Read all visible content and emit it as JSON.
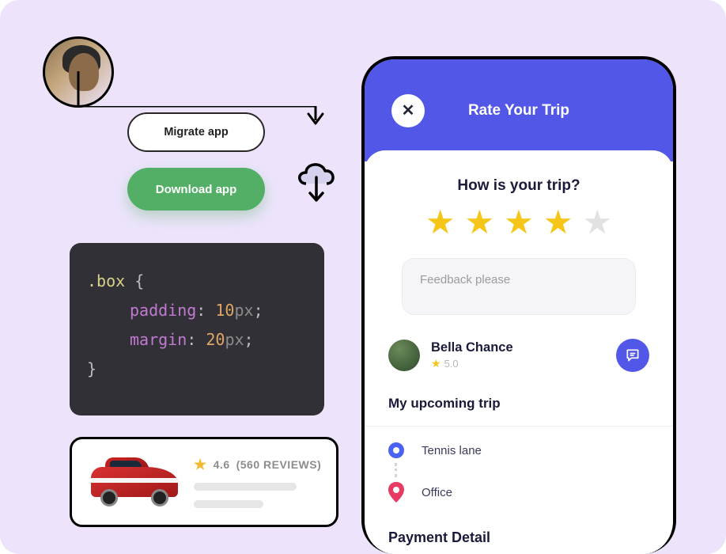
{
  "buttons": {
    "migrate": "Migrate app",
    "download": "Download app"
  },
  "code": {
    "selector": ".box",
    "prop1": "padding",
    "val1": "10",
    "unit1": "px",
    "prop2": "margin",
    "val2": "20",
    "unit2": "px"
  },
  "product": {
    "rating": "4.6",
    "reviews": "(560 REVIEWS)"
  },
  "phone": {
    "header_title": "Rate Your Trip",
    "question": "How is your trip?",
    "stars": 4,
    "feedback_placeholder": "Feedback please",
    "driver_name": "Bella Chance",
    "driver_rating": "5.0",
    "upcoming_header": "My upcoming trip",
    "origin": "Tennis lane",
    "destination": "Office",
    "payment_header": "Payment Detail"
  },
  "colors": {
    "accent_purple_bg": "#EDE4FC",
    "green": "#53AF65",
    "phone_blue": "#5257E8",
    "star": "#f5c518",
    "pin_red": "#E73B63"
  }
}
